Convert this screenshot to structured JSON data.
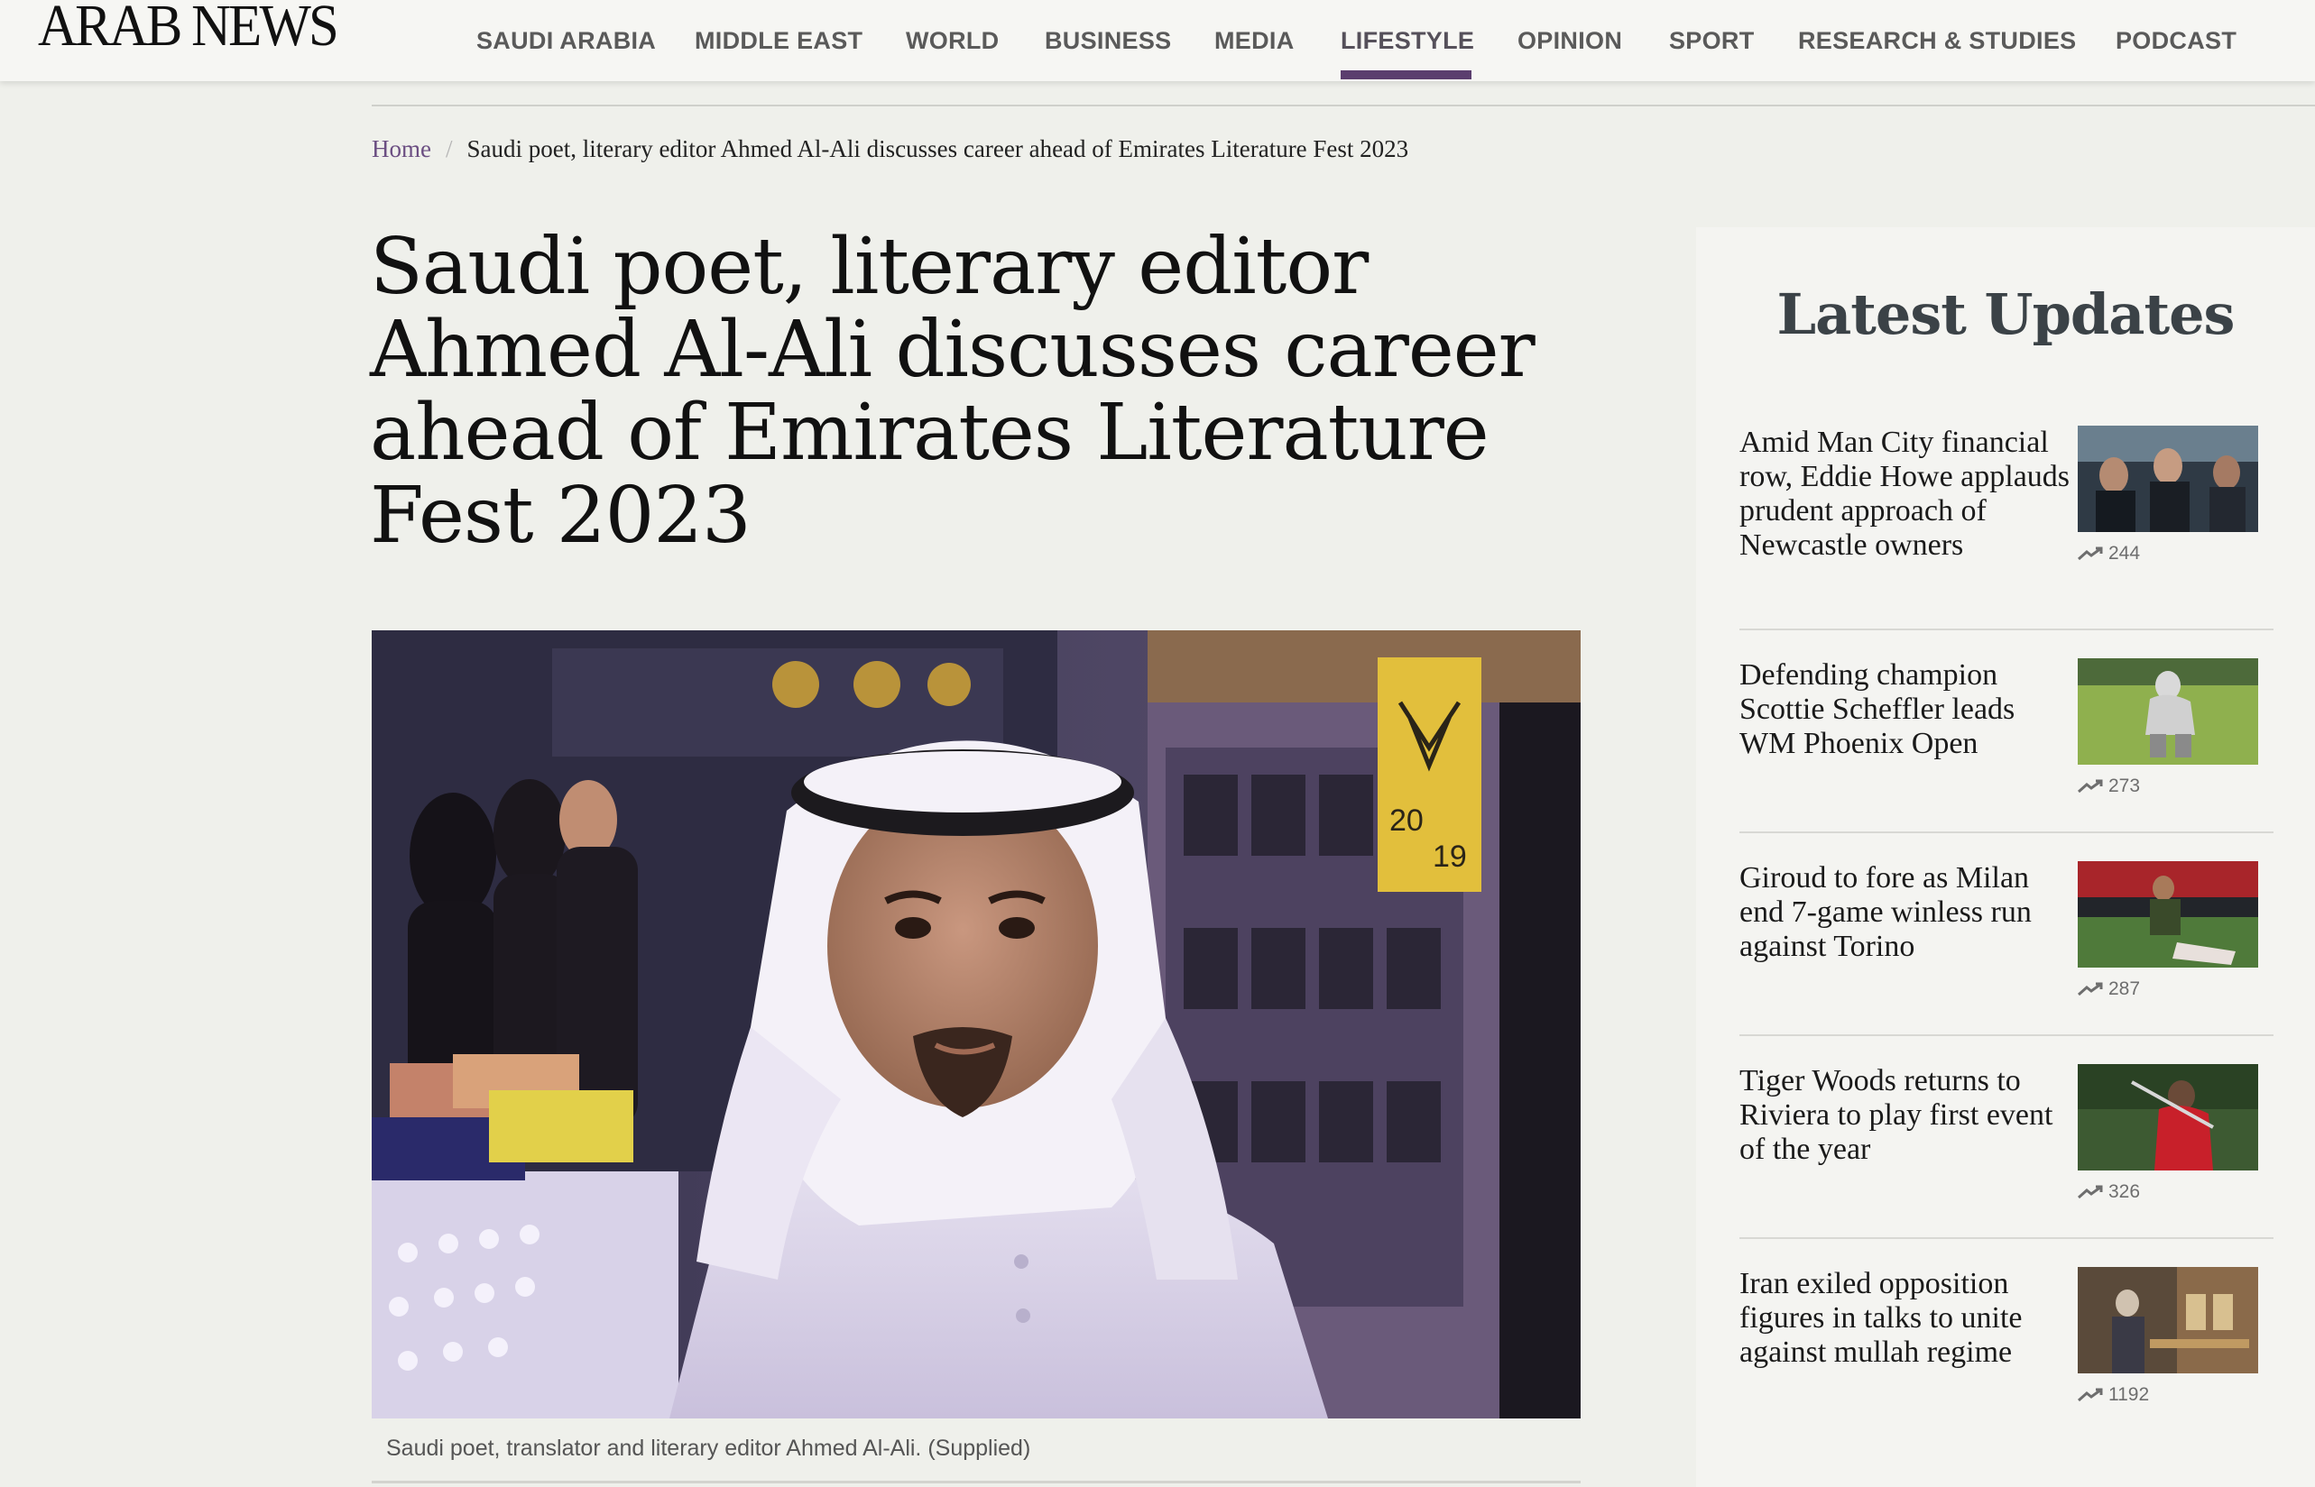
{
  "brand": {
    "name": "ARAB NEWS",
    "accent_color": "#5b3e6e"
  },
  "nav": {
    "items": [
      {
        "label": "SAUDI ARABIA"
      },
      {
        "label": "MIDDLE EAST"
      },
      {
        "label": "WORLD"
      },
      {
        "label": "BUSINESS"
      },
      {
        "label": "MEDIA"
      },
      {
        "label": "LIFESTYLE",
        "active": true
      },
      {
        "label": "OPINION"
      },
      {
        "label": "SPORT"
      },
      {
        "label": "RESEARCH & STUDIES"
      },
      {
        "label": "PODCAST"
      }
    ]
  },
  "breadcrumb": {
    "home": "Home",
    "separator": "/",
    "current": "Saudi poet, literary editor Ahmed Al-Ali discusses career ahead of Emirates Literature Fest 2023"
  },
  "article": {
    "headline_lines": [
      "Saudi poet, literary editor",
      "Ahmed Al-Ali discusses career",
      "ahead of Emirates Literature",
      "Fest 2023"
    ],
    "hero_caption": "Saudi poet, translator and literary editor Ahmed Al-Ali. (Supplied)",
    "booth_sign_number_top": "20",
    "booth_sign_number_bottom": "19"
  },
  "sidebar": {
    "title": "Latest Updates",
    "trend_icon": "trending-up-icon",
    "items": [
      {
        "title": "Amid Man City financial row, Eddie Howe applauds prudent approach of Newcastle owners",
        "views": "244"
      },
      {
        "title": "Defending champion Scottie Scheffler leads WM Phoenix Open",
        "views": "273"
      },
      {
        "title": "Giroud to fore as Milan end 7-game winless run against Torino",
        "views": "287"
      },
      {
        "title": "Tiger Woods returns to Riviera to play first event of the year",
        "views": "326"
      },
      {
        "title": "Iran exiled opposition figures in talks to unite against mullah regime",
        "views": "1192"
      }
    ]
  }
}
